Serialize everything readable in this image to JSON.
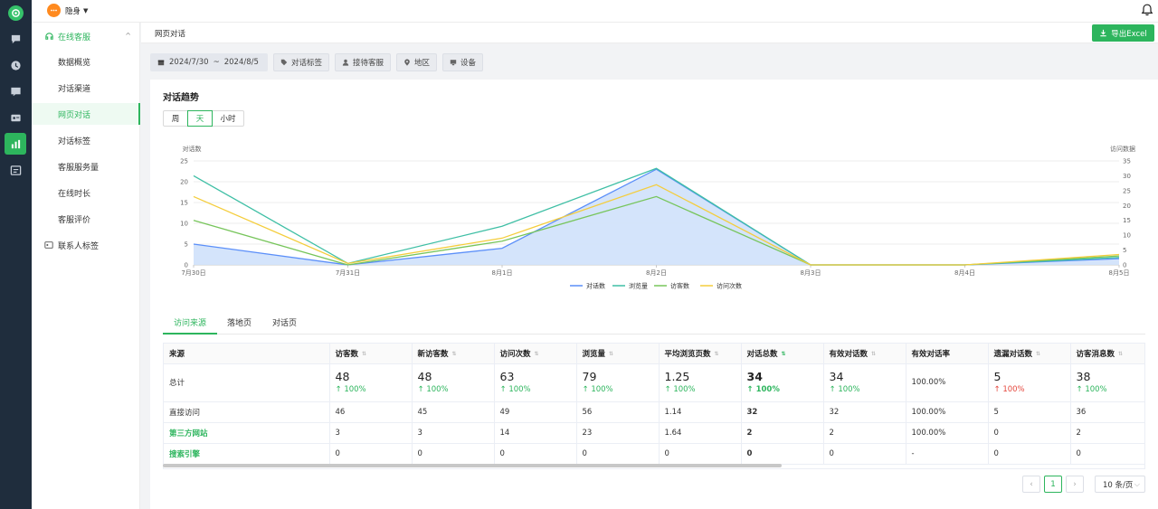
{
  "app": {
    "status_label": "隐身"
  },
  "sidebar": {
    "group_label": "在线客服",
    "items": [
      "数据概览",
      "对话渠道",
      "网页对话",
      "对话标签",
      "客服服务量",
      "在线时长",
      "客服评价"
    ],
    "active_index": 2,
    "group2_label": "联系人标签"
  },
  "page": {
    "title": "网页对话",
    "export_label": "导出Excel"
  },
  "filters": {
    "date_start": "2024/7/30",
    "date_sep": "~",
    "date_end": "2024/8/5",
    "tag": "对话标签",
    "agent": "接待客服",
    "region": "地区",
    "device": "设备"
  },
  "trend": {
    "title": "对话趋势",
    "granularity": [
      "周",
      "天",
      "小时"
    ],
    "active_granularity": 1
  },
  "chart_data": {
    "type": "line",
    "x": [
      "7月30日",
      "7月31日",
      "8月1日",
      "8月2日",
      "8月3日",
      "8月4日",
      "8月5日"
    ],
    "ylabel": "对话数",
    "y2label": "访问数据",
    "ylim": [
      0,
      25
    ],
    "y2lim": [
      0,
      35
    ],
    "yticks": [
      0,
      5,
      10,
      15,
      20,
      25
    ],
    "y2ticks": [
      0,
      5,
      10,
      15,
      20,
      25,
      30,
      35
    ],
    "grid": true,
    "legend_position": "bottom",
    "series": [
      {
        "name": "对话数",
        "axis": "left",
        "color": "#5b8ff9",
        "area": true,
        "values": [
          5,
          0,
          4,
          23,
          0,
          0,
          1.5
        ]
      },
      {
        "name": "浏览量",
        "axis": "right",
        "color": "#3fbfa5",
        "values": [
          30,
          0.5,
          13,
          32.5,
          0,
          0,
          2.5
        ]
      },
      {
        "name": "访客数",
        "axis": "right",
        "color": "#77c55b",
        "values": [
          15,
          0,
          8,
          23,
          0,
          0,
          3
        ]
      },
      {
        "name": "访问次数",
        "axis": "right",
        "color": "#f4cd3c",
        "values": [
          23,
          0.5,
          9,
          27,
          0,
          0,
          3.5
        ]
      }
    ]
  },
  "tabs": [
    "访问来源",
    "落地页",
    "对话页"
  ],
  "table": {
    "headers": [
      "来源",
      "访客数",
      "新访客数",
      "访问次数",
      "浏览量",
      "平均浏览页数",
      "对话总数",
      "有效对话数",
      "有效对话率",
      "遗漏对话数",
      "访客消息数"
    ],
    "total": {
      "label": "总计",
      "values": [
        "48",
        "48",
        "63",
        "79",
        "1.25",
        "34",
        "34",
        "100.00%",
        "5",
        "38"
      ],
      "changes": [
        "100%",
        "100%",
        "100%",
        "100%",
        "100%",
        "100%",
        "100%",
        "",
        "100%",
        "100%"
      ]
    },
    "rows": [
      {
        "source": "直接访问",
        "values": [
          "46",
          "45",
          "49",
          "56",
          "1.14",
          "32",
          "32",
          "100.00%",
          "5",
          "36"
        ]
      },
      {
        "source": "第三方网站",
        "values": [
          "3",
          "3",
          "14",
          "23",
          "1.64",
          "2",
          "2",
          "100.00%",
          "0",
          "2"
        ]
      },
      {
        "source": "搜索引擎",
        "values": [
          "0",
          "0",
          "0",
          "0",
          "0",
          "0",
          "0",
          "-",
          "0",
          "0"
        ]
      }
    ]
  },
  "pagination": {
    "current": "1",
    "page_size": "10 条/页"
  },
  "colors": {
    "accent": "#2db55d",
    "rail": "#1f2d3d",
    "danger": "#e5483e"
  }
}
